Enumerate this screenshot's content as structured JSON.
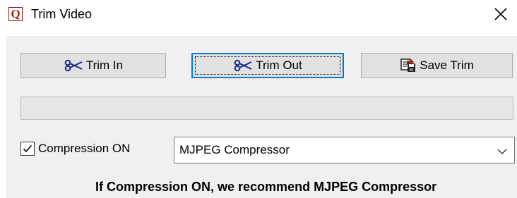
{
  "window": {
    "title": "Trim Video",
    "app_icon_letter": "Q"
  },
  "toolbar": {
    "trim_in_label": "Trim In",
    "trim_out_label": "Trim Out",
    "save_trim_label": "Save Trim",
    "focused_button": "trim-out"
  },
  "progress": {
    "value_percent": 0
  },
  "compression": {
    "checkbox_label": "Compression ON",
    "checked": true,
    "selected_compressor": "MJPEG Compressor"
  },
  "note": "If Compression ON, we recommend MJPEG Compressor",
  "icons": {
    "trim_in": "scissors-icon",
    "trim_out": "scissors-icon",
    "save_trim": "save-disk-icon",
    "close": "close-icon",
    "dropdown": "chevron-down-icon"
  },
  "colors": {
    "focus": "#0078d7",
    "dialog_bg": "#f0f0f0",
    "icon_red": "#b01d14",
    "scissors_blue": "#1a2a8a"
  }
}
